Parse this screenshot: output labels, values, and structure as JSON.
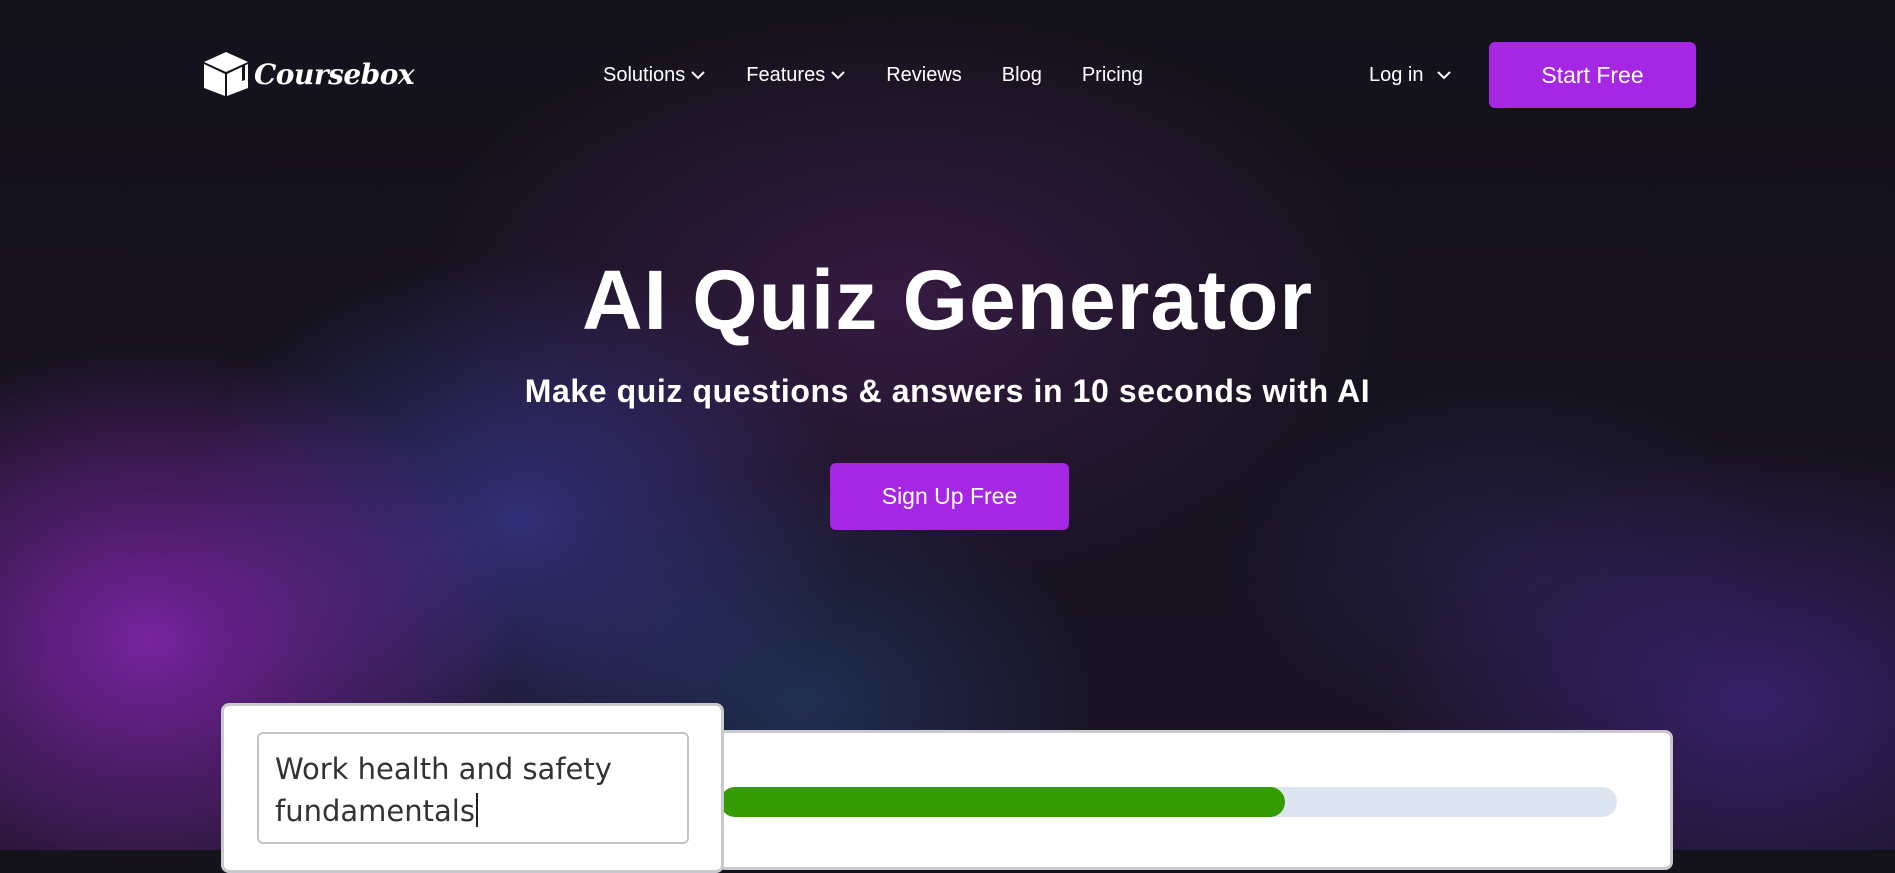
{
  "header": {
    "logo_text": "Coursebox",
    "nav": [
      {
        "label": "Solutions",
        "has_dropdown": true
      },
      {
        "label": "Features",
        "has_dropdown": true
      },
      {
        "label": "Reviews",
        "has_dropdown": false
      },
      {
        "label": "Blog",
        "has_dropdown": false
      },
      {
        "label": "Pricing",
        "has_dropdown": false
      }
    ],
    "login_label": "Log in",
    "start_label": "Start Free"
  },
  "hero": {
    "title": "AI Quiz Generator",
    "subtitle": "Make quiz questions & answers in 10 seconds with AI",
    "signup_label": "Sign Up Free"
  },
  "demo": {
    "topic_text": "Work health and safety fundamentals",
    "progress_fraction": 0.63
  },
  "colors": {
    "brand_purple": "#a526e3",
    "progress_green": "#369c04",
    "progress_track": "#dde6f0",
    "background_dark": "#14121b"
  },
  "icons": {
    "logo": "graduation-cap-box-icon",
    "dropdown": "chevron-down-icon"
  }
}
